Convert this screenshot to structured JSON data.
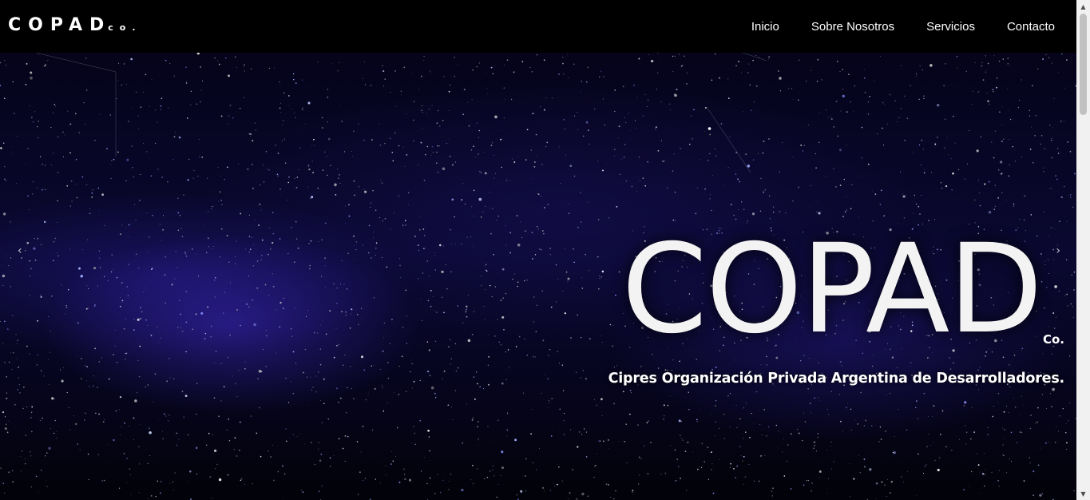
{
  "navbar": {
    "brand": "COPAD",
    "brand_suffix": "co.",
    "links": [
      "Inicio",
      "Sobre Nosotros",
      "Servicios",
      "Contacto"
    ]
  },
  "hero": {
    "title": "COPAD",
    "title_suffix": "Co.",
    "subtitle": "Cipres Organización Privada Argentina de Desarrolladores."
  },
  "carousel": {
    "prev_icon": "chevron-left-icon",
    "next_icon": "chevron-right-icon"
  },
  "colors": {
    "navbar_bg": "#000000",
    "text": "#ffffff",
    "space_accent": "#3c28be"
  }
}
